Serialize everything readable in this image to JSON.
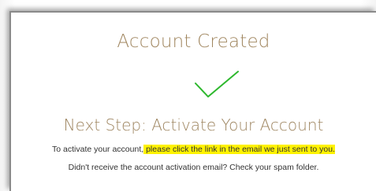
{
  "colors": {
    "heading": "#a0865f",
    "check": "#2eb82e",
    "highlight": "#fff200",
    "body_text": "#333333"
  },
  "confirmation": {
    "title": "Account Created",
    "icon": "checkmark-icon",
    "next_step_heading": "Next Step: Activate Your Account",
    "instruction_prefix": "To activate your account,",
    "instruction_highlight": " please click the link in the email we just sent to you.",
    "spam_note": "Didn't receive the account activation email? Check your spam folder."
  }
}
